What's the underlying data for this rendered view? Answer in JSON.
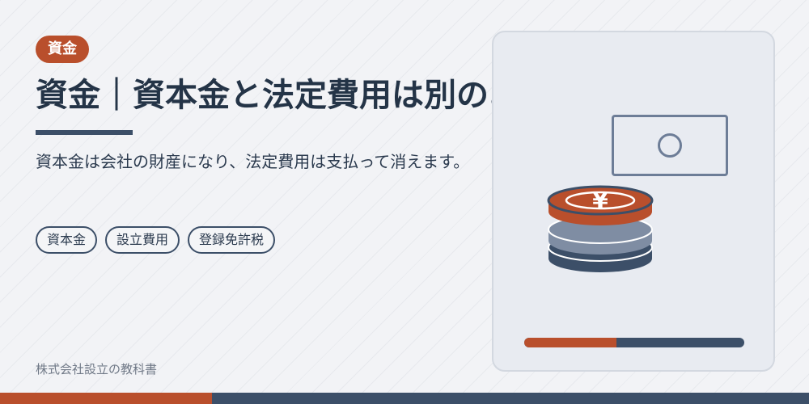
{
  "badge": "資金",
  "title": "資金｜資本金と法定費用は別のお金",
  "description": "資本金は会社の財産になり、法定費用は支払って消えます。",
  "tags": [
    "資本金",
    "設立費用",
    "登録免許税"
  ],
  "footer": "株式会社設立の教科書",
  "coin_symbol": "¥",
  "progress": 0.42,
  "colors": {
    "accent": "#b94f2c",
    "navy": "#3c4f68",
    "slate": "#7f8da3",
    "background": "#f2f3f6"
  },
  "icons": [
    "banknote-icon",
    "coin-stack-icon"
  ]
}
